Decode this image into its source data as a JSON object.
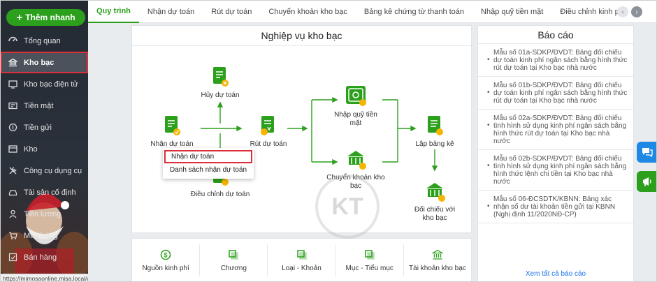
{
  "sidebar": {
    "add_label": "Thêm nhanh",
    "items": [
      {
        "label": "Tổng quan",
        "icon": "dashboard-icon",
        "active": false
      },
      {
        "label": "Kho bạc",
        "icon": "bank-icon",
        "active": true
      },
      {
        "label": "Kho bạc điện tử",
        "icon": "e-treasury-icon",
        "active": false
      },
      {
        "label": "Tiền mặt",
        "icon": "cash-icon",
        "active": false
      },
      {
        "label": "Tiền gửi",
        "icon": "deposit-icon",
        "active": false
      },
      {
        "label": "Kho",
        "icon": "warehouse-icon",
        "active": false
      },
      {
        "label": "Công cụ dụng cụ",
        "icon": "tools-icon",
        "active": false
      },
      {
        "label": "Tài sản cố định",
        "icon": "car-icon",
        "active": false
      },
      {
        "label": "Tiền lương",
        "icon": "salary-icon",
        "active": false
      },
      {
        "label": "Mua hàng",
        "icon": "cart-icon",
        "active": false
      },
      {
        "label": "Bán hàng",
        "icon": "sales-icon",
        "active": false
      }
    ]
  },
  "status_url": "https://mimosaonline.misa.local/asset",
  "tabs": [
    "Quy trình",
    "Nhận dự toán",
    "Rút dự toán",
    "Chuyển khoản kho bạc",
    "Bảng kê chứng từ thanh toán",
    "Nhập quỹ tiền mặt",
    "Điều chỉnh kinh phí"
  ],
  "process": {
    "title": "Nghiệp vụ kho bạc",
    "nodes": {
      "receive": "Nhận dự toán",
      "cancel": "Hủy dự toán",
      "adjust": "Điều chỉnh dự toán",
      "withdraw": "Rút dự toán",
      "cash_in": "Nhập quỹ tiền mặt",
      "transfer": "Chuyển khoản kho bạc",
      "list": "Lập bảng kê",
      "reconcile": "Đối chiếu với kho bạc"
    },
    "popup": [
      "Nhận dự toán",
      "Danh sách nhận dự toán"
    ]
  },
  "categories": [
    {
      "label": "Nguồn kinh phí",
      "icon": "money-source-icon"
    },
    {
      "label": "Chương",
      "icon": "chapter-icon"
    },
    {
      "label": "Loại - Khoản",
      "icon": "type-item-icon"
    },
    {
      "label": "Mục - Tiểu mục",
      "icon": "sub-item-icon"
    },
    {
      "label": "Tài khoản kho bạc",
      "icon": "treasury-account-icon"
    }
  ],
  "reports": {
    "title": "Báo cáo",
    "items": [
      "Mẫu số 01a-SDKP/ĐVDT: Bảng đối chiếu dự toán kinh phí ngân sách bằng hình thức rút dự toán tại Kho bạc nhà nước",
      "Mẫu số 01b-SDKP/ĐVDT: Bảng đối chiếu dự toán kinh phí ngân sách bằng hình thức rút dự toán tại Kho bạc nhà nước",
      "Mẫu số 02a-SDKP/ĐVDT: Bảng đối chiếu tình hình sử dụng kinh phí ngân sách bằng hình thức rút dự toán tại Kho bạc nhà nước",
      "Mẫu số 02b-SDKP/ĐVDT: Bảng đối chiếu tình hình sử dụng kinh phí ngân sách bằng hình thức lệnh chi tiền tại Kho bạc nhà nước",
      "Mẫu số 06-ĐCSDTK/KBNN: Bảng xác nhận số dư tài khoản tiền gửi tại KBNN (Nghị định 11/2020NĐ-CP)"
    ],
    "more": "Xem tất cả báo cáo"
  },
  "colors": {
    "accent": "#2ca01c",
    "highlight": "#d9303a",
    "link": "#1a73e8"
  }
}
